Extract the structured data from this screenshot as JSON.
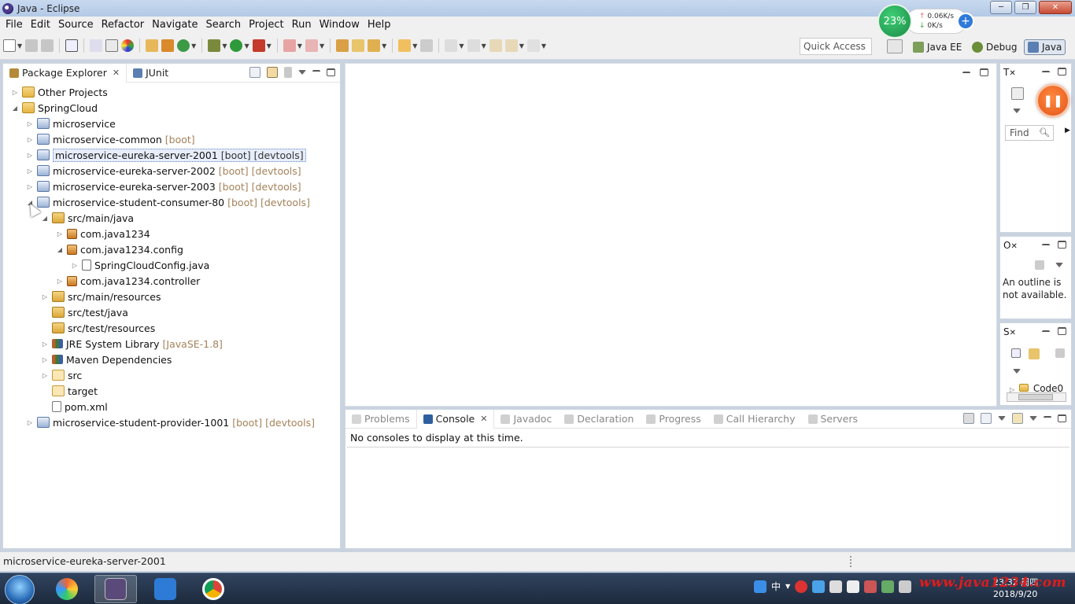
{
  "window": {
    "title": "Java - Eclipse",
    "controls": [
      "─",
      "❐",
      "✕"
    ]
  },
  "menu": [
    "File",
    "Edit",
    "Source",
    "Refactor",
    "Navigate",
    "Search",
    "Project",
    "Run",
    "Window",
    "Help"
  ],
  "toolbar": {
    "quick_access": "Quick Access",
    "perspectives": [
      {
        "label": "Java EE",
        "active": false
      },
      {
        "label": "Debug",
        "active": false
      },
      {
        "label": "Java",
        "active": true
      }
    ]
  },
  "network_widget": {
    "percent": "23%",
    "up": "0.06K/s",
    "down": "0K/s"
  },
  "package_explorer": {
    "tabs": [
      {
        "label": "Package Explorer",
        "active": true
      },
      {
        "label": "JUnit",
        "active": false
      }
    ],
    "tree": [
      {
        "label": "Other Projects",
        "decoration": "",
        "level": 0,
        "icon": "folder",
        "twisty": "▷"
      },
      {
        "label": "SpringCloud",
        "decoration": "",
        "level": 0,
        "icon": "folder",
        "twisty": "◢"
      },
      {
        "label": "microservice",
        "decoration": "",
        "level": 1,
        "icon": "project",
        "twisty": "▷"
      },
      {
        "label": "microservice-common",
        "decoration": "[boot]",
        "level": 1,
        "icon": "project",
        "twisty": "▷"
      },
      {
        "label": "microservice-eureka-server-2001",
        "decoration": "[boot] [devtools]",
        "level": 1,
        "icon": "project",
        "twisty": "▷",
        "selected": true
      },
      {
        "label": "microservice-eureka-server-2002",
        "decoration": "[boot] [devtools]",
        "level": 1,
        "icon": "project",
        "twisty": "▷"
      },
      {
        "label": "microservice-eureka-server-2003",
        "decoration": "[boot] [devtools]",
        "level": 1,
        "icon": "project",
        "twisty": "▷"
      },
      {
        "label": "microservice-student-consumer-80",
        "decoration": "[boot] [devtools]",
        "level": 1,
        "icon": "project",
        "twisty": "◢"
      },
      {
        "label": "src/main/java",
        "decoration": "",
        "level": 2,
        "icon": "srcfolder",
        "twisty": "◢"
      },
      {
        "label": "com.java1234",
        "decoration": "",
        "level": 3,
        "icon": "package",
        "twisty": "▷"
      },
      {
        "label": "com.java1234.config",
        "decoration": "",
        "level": 3,
        "icon": "package",
        "twisty": "◢"
      },
      {
        "label": "SpringCloudConfig.java",
        "decoration": "",
        "level": 4,
        "icon": "java",
        "twisty": "▷"
      },
      {
        "label": "com.java1234.controller",
        "decoration": "",
        "level": 3,
        "icon": "package",
        "twisty": "▷"
      },
      {
        "label": "src/main/resources",
        "decoration": "",
        "level": 2,
        "icon": "srcfolder",
        "twisty": "▷"
      },
      {
        "label": "src/test/java",
        "decoration": "",
        "level": 2,
        "icon": "srcfolder",
        "twisty": ""
      },
      {
        "label": "src/test/resources",
        "decoration": "",
        "level": 2,
        "icon": "srcfolder",
        "twisty": ""
      },
      {
        "label": "JRE System Library",
        "decoration": "[JavaSE-1.8]",
        "level": 2,
        "icon": "library",
        "twisty": "▷"
      },
      {
        "label": "Maven Dependencies",
        "decoration": "",
        "level": 2,
        "icon": "library",
        "twisty": "▷"
      },
      {
        "label": "src",
        "decoration": "",
        "level": 2,
        "icon": "emptyfolder",
        "twisty": "▷"
      },
      {
        "label": "target",
        "decoration": "",
        "level": 2,
        "icon": "emptyfolder",
        "twisty": ""
      },
      {
        "label": "pom.xml",
        "decoration": "",
        "level": 2,
        "icon": "xml",
        "twisty": ""
      },
      {
        "label": "microservice-student-provider-1001",
        "decoration": "[boot] [devtools]",
        "level": 1,
        "icon": "project",
        "twisty": "▷"
      }
    ]
  },
  "console_view": {
    "tabs": [
      {
        "label": "Problems",
        "active": false
      },
      {
        "label": "Console",
        "active": true
      },
      {
        "label": "Javadoc",
        "active": false
      },
      {
        "label": "Declaration",
        "active": false
      },
      {
        "label": "Progress",
        "active": false
      },
      {
        "label": "Call Hierarchy",
        "active": false
      },
      {
        "label": "Servers",
        "active": false
      }
    ],
    "message": "No consoles to display at this time."
  },
  "task_view": {
    "tab": "T",
    "find_label": "Find"
  },
  "outline_view": {
    "tab": "O",
    "message_line1": "An outline is",
    "message_line2": "not available."
  },
  "s_view": {
    "tab": "S",
    "item": "Code0"
  },
  "statusbar": {
    "text": "microservice-eureka-server-2001"
  },
  "taskbar": {
    "ime": "中",
    "clock_time": "23:32 周四",
    "clock_date": "2018/9/20",
    "watermark": "www.java1234.com"
  },
  "colors": {
    "accent": "#3d6fb6",
    "decoration": "#a5825a",
    "pause": "#e4541b"
  }
}
